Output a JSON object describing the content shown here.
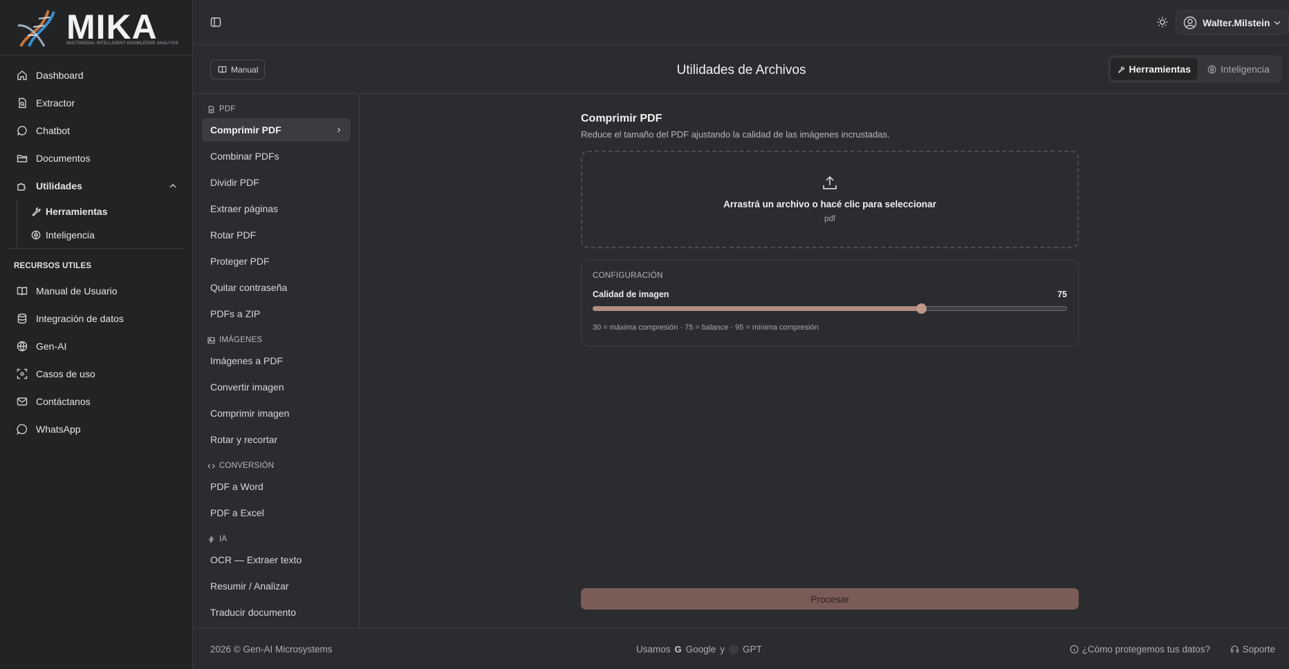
{
  "brand": {
    "name": "MIKA",
    "tagline": "MULTIMODAL INTELLIGENT KNOWLEDGE ANALYSIS"
  },
  "sidebar": {
    "items": [
      {
        "label": "Dashboard",
        "icon": "home-icon"
      },
      {
        "label": "Extractor",
        "icon": "file-scan-icon"
      },
      {
        "label": "Chatbot",
        "icon": "chat-bubble-icon"
      },
      {
        "label": "Documentos",
        "icon": "folder-icon"
      },
      {
        "label": "Utilidades",
        "icon": "puzzle-icon",
        "expanded": true
      }
    ],
    "sub_items": [
      {
        "label": "Herramientas",
        "icon": "wrench-icon",
        "active": true
      },
      {
        "label": "Inteligencia",
        "icon": "brain-icon"
      }
    ],
    "resources_label": "RECURSOS UTILES",
    "resources": [
      {
        "label": "Manual de Usuario",
        "icon": "book-icon"
      },
      {
        "label": "Integración de datos",
        "icon": "database-icon"
      },
      {
        "label": "Gen-AI",
        "icon": "globe-icon"
      },
      {
        "label": "Casos de uso",
        "icon": "scan-icon"
      },
      {
        "label": "Contáctanos",
        "icon": "mail-icon"
      },
      {
        "label": "WhatsApp",
        "icon": "whatsapp-icon"
      }
    ]
  },
  "topbar": {
    "username": "Walter.Milstein"
  },
  "header": {
    "manual_label": "Manual",
    "title": "Utilidades de Archivos",
    "tabs": [
      {
        "label": "Herramientas",
        "active": true
      },
      {
        "label": "Inteligencia",
        "active": false
      }
    ]
  },
  "tools": {
    "groups": [
      {
        "label": "PDF",
        "icon": "pdf-file-icon",
        "items": [
          "Comprimir PDF",
          "Combinar PDFs",
          "Dividir PDF",
          "Extraer páginas",
          "Rotar PDF",
          "Proteger PDF",
          "Quitar contraseña",
          "PDFs a ZIP"
        ]
      },
      {
        "label": "IMÁGENES",
        "icon": "image-icon",
        "items": [
          "Imágenes a PDF",
          "Convertir imagen",
          "Comprimir imagen",
          "Rotar y recortar"
        ]
      },
      {
        "label": "CONVERSIÓN",
        "icon": "code-icon",
        "items": [
          "PDF a Word",
          "PDF a Excel"
        ]
      },
      {
        "label": "IA",
        "icon": "sparkle-icon",
        "items": [
          "OCR — Extraer texto",
          "Resumir / Analizar",
          "Traducir documento"
        ]
      }
    ],
    "active": "Comprimir PDF"
  },
  "panel": {
    "title": "Comprimir PDF",
    "description": "Reduce el tamaño del PDF ajustando la calidad de las imágenes incrustadas.",
    "dropzone_text": "Arrastrá un archivo o hacé clic para seleccionar",
    "dropzone_sub": "pdf",
    "config_title": "CONFIGURACIÓN",
    "quality_label": "Calidad de imagen",
    "quality_value": "75",
    "quality_min": 30,
    "quality_max": 95,
    "quality_hint": "30 = máxima compresión · 75 = balance · 95 = mínima compresión",
    "process_label": "Procesar"
  },
  "footer": {
    "copyright": "2026 © Gen-AI Microsystems",
    "usamos": "Usamos",
    "google": "Google",
    "y": "y",
    "gpt": "GPT",
    "privacy": "¿Cómo protegemos tus datos?",
    "support": "Soporte"
  },
  "colors": {
    "accent": "#b38d80",
    "process_button": "#7a5c56",
    "background": "#2a2c2f",
    "sidebar": "#212325"
  }
}
